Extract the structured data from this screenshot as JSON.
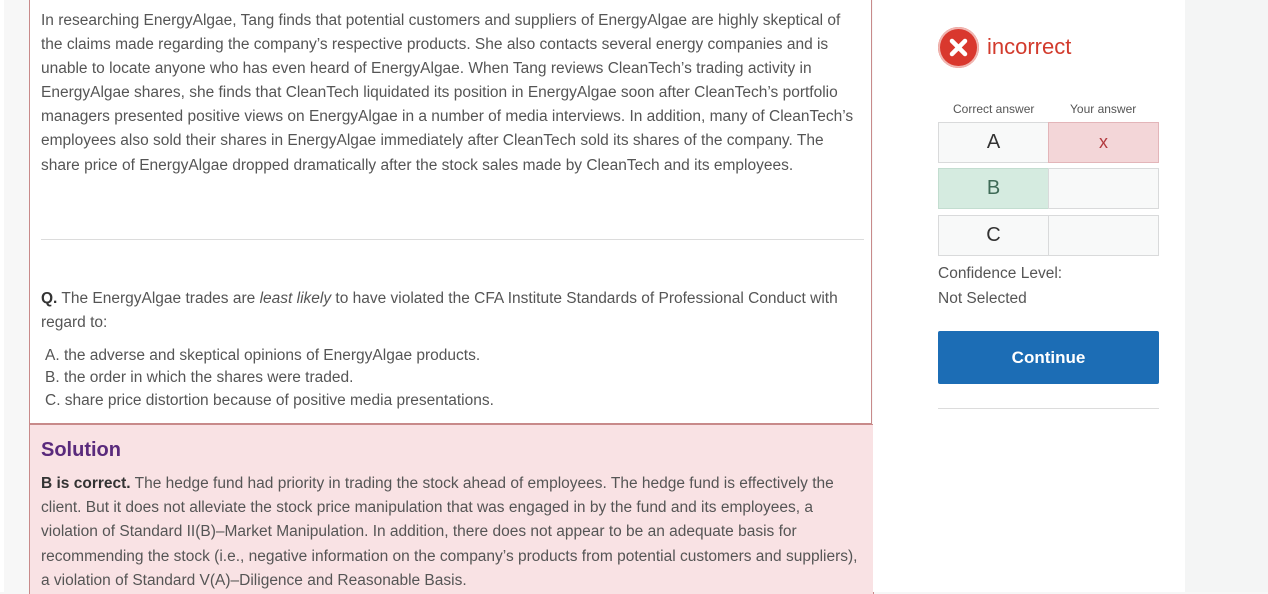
{
  "passage": "In researching EnergyAlgae, Tang finds that potential customers and suppliers of EnergyAlgae are highly skeptical of the claims made regarding the company’s respective products. She also contacts several energy companies and is unable to locate anyone who has even heard of EnergyAlgae. When Tang reviews CleanTech’s trading activity in EnergyAlgae shares, she finds that CleanTech liquidated its position in EnergyAlgae soon after CleanTech’s portfolio managers presented positive views on EnergyAlgae in a number of media interviews. In addition, many of CleanTech’s employees also sold their shares in EnergyAlgae immediately after CleanTech sold its shares of the company. The share price of EnergyAlgae dropped dramatically after the stock sales made by CleanTech and its employees.",
  "question": {
    "prefix": "Q.",
    "text_before": " The EnergyAlgae trades are ",
    "emphasis": "least likely",
    "text_after": " to have violated the CFA Institute Standards of Professional Conduct with regard to:",
    "options": [
      "A. the adverse and skeptical opinions of EnergyAlgae products.",
      "B. the order in which the shares were traded.",
      "C. share price distortion because of positive media presentations."
    ]
  },
  "solution": {
    "title": "Solution",
    "lead": "B is correct.",
    "text": " The hedge fund had priority in trading the stock ahead of employees. The hedge fund is effectively the client. But it does not alleviate the stock price manipulation that was engaged in by the fund and its employees, a violation of Standard II(B)–Market Manipulation. In addition, there does not appear to be an adequate basis for recommending the stock (i.e., negative information on the company’s products from potential customers and suppliers), a violation of Standard V(A)–Diligence and Reasonable Basis."
  },
  "result": {
    "icon": "x-circle-icon",
    "status": "incorrect",
    "color": "#d9382e"
  },
  "answers": {
    "correct_header": "Correct answer",
    "yours_header": "Your answer",
    "rows": [
      {
        "letter": "A",
        "your_mark": "x"
      },
      {
        "letter": "B",
        "your_mark": ""
      },
      {
        "letter": "C",
        "your_mark": ""
      }
    ],
    "correct_color": "#d5ebe0",
    "wrong_color": "#f3d6d8"
  },
  "confidence": {
    "label": "Confidence Level:",
    "value": "Not Selected"
  },
  "continue_label": "Continue",
  "accent_color": "#1c6db5"
}
